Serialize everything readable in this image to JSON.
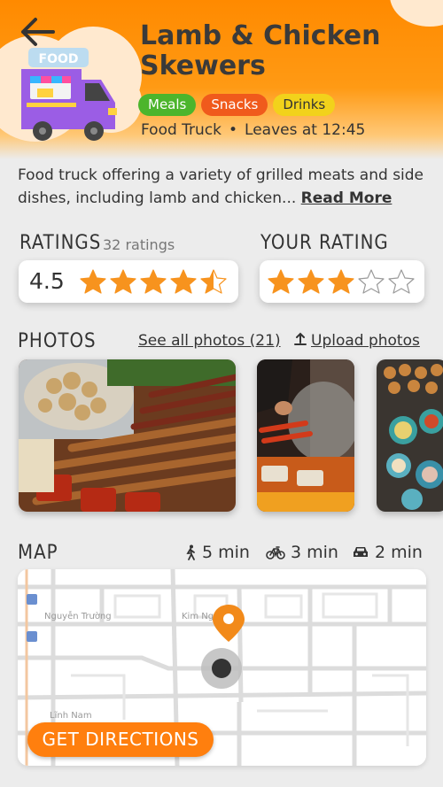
{
  "header": {
    "title": "Lamb & Chicken Skewers",
    "truck_sign": "FOOD",
    "tags": [
      "Meals",
      "Snacks",
      "Drinks"
    ],
    "category": "Food Truck",
    "separator": "•",
    "leaves": "Leaves at 12:45",
    "back_icon": "arrow-left-icon",
    "accent_color": "#ff8a00"
  },
  "description": {
    "text": "Food truck offering a variety of grilled meats and side dishes, including lamb and chicken...",
    "read_more": "Read More"
  },
  "ratings": {
    "label": "RATINGS",
    "count": "32 ratings",
    "value": "4.5",
    "stars_filled": 4.5,
    "stars_total": 5
  },
  "your_rating": {
    "label": "YOUR RATING",
    "stars_filled": 3,
    "stars_total": 5
  },
  "photos": {
    "label": "PHOTOS",
    "see_all": "See all photos (21)",
    "upload": "Upload photos",
    "upload_icon": "upload-icon"
  },
  "map": {
    "label": "MAP",
    "walk": "5 min",
    "bike": "3 min",
    "car": "2 min",
    "street_1": "Nguyễn Trường",
    "street_2": "Kim Ngưu",
    "street_3": "Lĩnh Nam",
    "directions": "GET DIRECTIONS"
  }
}
